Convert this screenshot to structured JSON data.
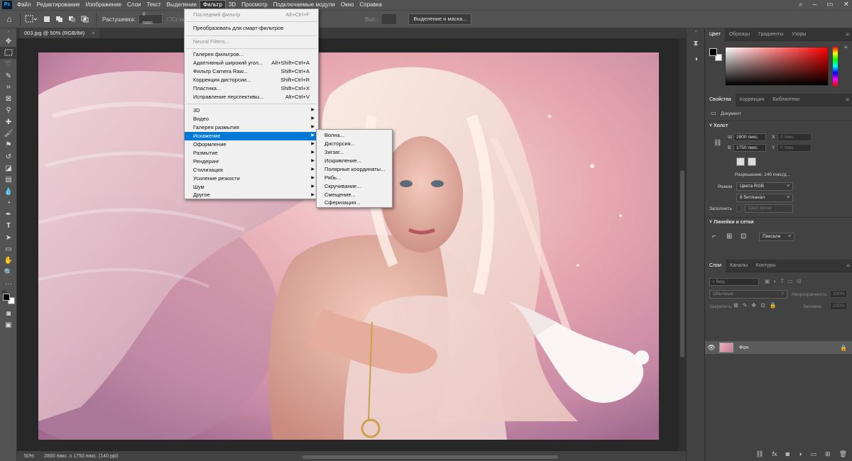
{
  "app": {
    "logo": "Ps"
  },
  "menubar": {
    "items": [
      "Файл",
      "Редактирование",
      "Изображение",
      "Слои",
      "Текст",
      "Выделение",
      "Фильтр",
      "3D",
      "Просмотр",
      "Подключаемые модули",
      "Окно",
      "Справка"
    ],
    "active_index": 6,
    "window_controls": [
      "search-icon",
      "minimize-icon",
      "maximize-icon",
      "close-icon"
    ]
  },
  "options_bar": {
    "feather_label": "Растушевка:",
    "feather_value": "0 пикс.",
    "smooth_label": "Сглажив.",
    "height_label": "Выс.:",
    "select_mask_button": "Выделение и маска..."
  },
  "document_tab": {
    "title": "003.jpg @ 50% (RGB/8#)",
    "close": "×"
  },
  "status_bar": {
    "zoom": "50%",
    "doc_info": "2800 пикс. x 1750 пикс. (140 ppi)"
  },
  "filter_menu": {
    "items": [
      {
        "label": "Последний фильтр",
        "shortcut": "Alt+Ctrl+F",
        "disabled": true
      },
      {
        "label": "Преобразовать для смарт-фильтров",
        "shortcut": ""
      },
      {
        "label": "Neural Filters...",
        "shortcut": "",
        "disabled": true
      },
      {
        "label": "Галерея фильтров...",
        "shortcut": ""
      },
      {
        "label": "Адаптивный широкий угол...",
        "shortcut": "Alt+Shift+Ctrl+A"
      },
      {
        "label": "Фильтр Camera Raw...",
        "shortcut": "Shift+Ctrl+A"
      },
      {
        "label": "Коррекция дисторсии...",
        "shortcut": "Shift+Ctrl+R"
      },
      {
        "label": "Пластика...",
        "shortcut": "Shift+Ctrl+X"
      },
      {
        "label": "Исправление перспективы...",
        "shortcut": "Alt+Ctrl+V"
      },
      {
        "label": "3D",
        "submenu": true
      },
      {
        "label": "Видео",
        "submenu": true
      },
      {
        "label": "Галерея размытия",
        "submenu": true
      },
      {
        "label": "Искажение",
        "submenu": true,
        "highlighted": true
      },
      {
        "label": "Оформление",
        "submenu": true
      },
      {
        "label": "Размытие",
        "submenu": true
      },
      {
        "label": "Рендеринг",
        "submenu": true
      },
      {
        "label": "Стилизация",
        "submenu": true
      },
      {
        "label": "Усиление резкости",
        "submenu": true
      },
      {
        "label": "Шум",
        "submenu": true
      },
      {
        "label": "Другое",
        "submenu": true
      }
    ]
  },
  "distort_submenu": {
    "items": [
      "Волна...",
      "Дисторсия...",
      "Зигзаг...",
      "Искривление...",
      "Полярные координаты...",
      "Рябь...",
      "Скручивание...",
      "Смещение...",
      "Сферизация..."
    ]
  },
  "color_panel": {
    "tabs": [
      "Цвет",
      "Образцы",
      "Градиенты",
      "Узоры"
    ],
    "foreground": "#000000",
    "background": "#ffffff",
    "hue": "#ff0000"
  },
  "properties_panel": {
    "tabs": [
      "Свойства",
      "Коррекция",
      "Библиотеки"
    ],
    "doc_label": "Документ",
    "canvas_section": "Холст",
    "w_label": "Ш",
    "w_value": "2800 пикс.",
    "x_label": "X",
    "x_value": "0 пикс.",
    "h_label": "В",
    "h_value": "1750 пикс.",
    "y_label": "Y",
    "y_value": "0 пикс.",
    "resolution": "Разрешение: 140 пикс/д...",
    "mode_label": "Режим",
    "mode_value": "Цвета RGB",
    "depth_value": "8 бит/канал",
    "fill_label": "Заполнить",
    "fill_value": "Цвет фона",
    "rulers_section": "Линейки и сетки",
    "units_value": "Пиксели"
  },
  "layers_panel": {
    "tabs": [
      "Слои",
      "Каналы",
      "Контуры"
    ],
    "filter_placeholder": "Вид",
    "blend_mode": "Обычные",
    "opacity_label": "Непрозрачность:",
    "opacity_value": "100%",
    "lock_label": "Закрепить:",
    "fill_label": "Заливка:",
    "fill_value": "100%",
    "layers": [
      {
        "name": "Фон",
        "visible": true,
        "locked": true
      }
    ]
  },
  "colors": {
    "ui_dark": "#282828",
    "ui_mid": "#424242",
    "ui_bar": "#535353",
    "menu_bg": "#f0f0f0",
    "menu_highlight": "#0078d7"
  }
}
